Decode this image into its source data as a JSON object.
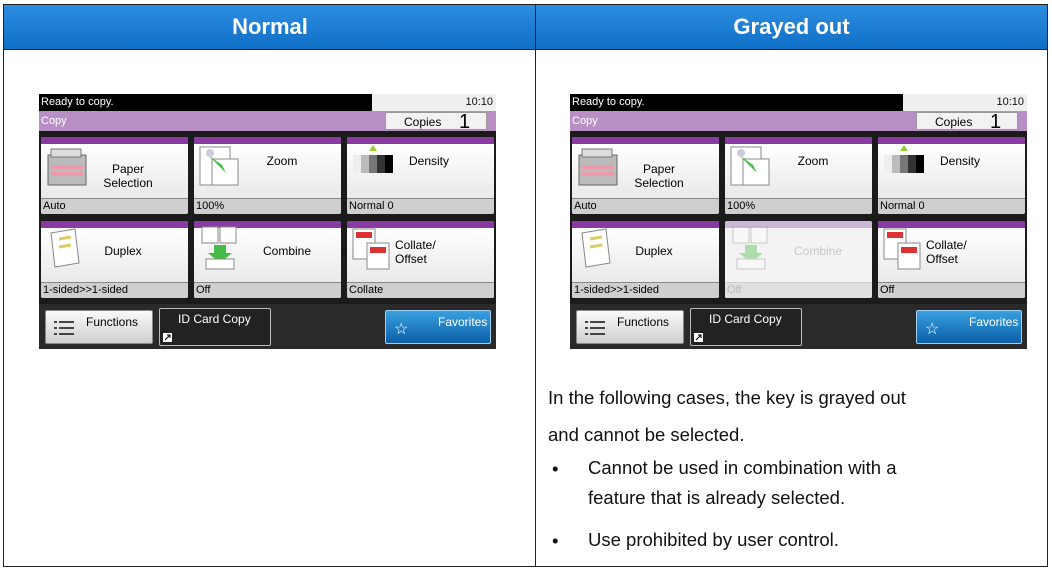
{
  "headers": {
    "normal": "Normal",
    "grayed": "Grayed out"
  },
  "panels": {
    "normal": {
      "status": "Ready to copy.",
      "time": "10:10",
      "mode": "Copy",
      "copies_label": "Copies",
      "copies_value": "1",
      "keys": [
        {
          "label": "Paper Selection",
          "value": "Auto",
          "icon": "paper-tray-icon"
        },
        {
          "label": "Zoom",
          "value": "100%",
          "icon": "zoom-icon"
        },
        {
          "label": "Density",
          "value": "Normal 0",
          "icon": "density-icon"
        },
        {
          "label": "Duplex",
          "value": "1-sided>>1-sided",
          "icon": "duplex-icon"
        },
        {
          "label": "Combine",
          "value": "Off",
          "icon": "combine-icon"
        },
        {
          "label": "Collate/ Offset",
          "value": "Collate",
          "icon": "collate-icon"
        }
      ],
      "buttons": {
        "functions": "Functions",
        "idcard": "ID Card Copy",
        "favorites": "Favorites"
      }
    },
    "grayed": {
      "status": "Ready to copy.",
      "time": "10:10",
      "mode": "Copy",
      "copies_label": "Copies",
      "copies_value": "1",
      "keys": [
        {
          "label": "Paper Selection",
          "value": "Auto",
          "icon": "paper-tray-icon"
        },
        {
          "label": "Zoom",
          "value": "100%",
          "icon": "zoom-icon"
        },
        {
          "label": "Density",
          "value": "Normal 0",
          "icon": "density-icon"
        },
        {
          "label": "Duplex",
          "value": "1-sided>>1-sided",
          "icon": "duplex-icon"
        },
        {
          "label": "Combine",
          "value": "Off",
          "icon": "combine-icon",
          "grayed": true
        },
        {
          "label": "Collate/ Offset",
          "value": "Off",
          "icon": "collate-icon"
        }
      ],
      "buttons": {
        "functions": "Functions",
        "idcard": "ID Card Copy",
        "favorites": "Favorites"
      }
    }
  },
  "description": {
    "line1": "In the following cases, the key is grayed out",
    "line2": "and cannot be selected.",
    "bullets": [
      [
        "Cannot be used in combination with a",
        "feature that is already selected."
      ],
      [
        "Use prohibited by user control."
      ]
    ]
  }
}
